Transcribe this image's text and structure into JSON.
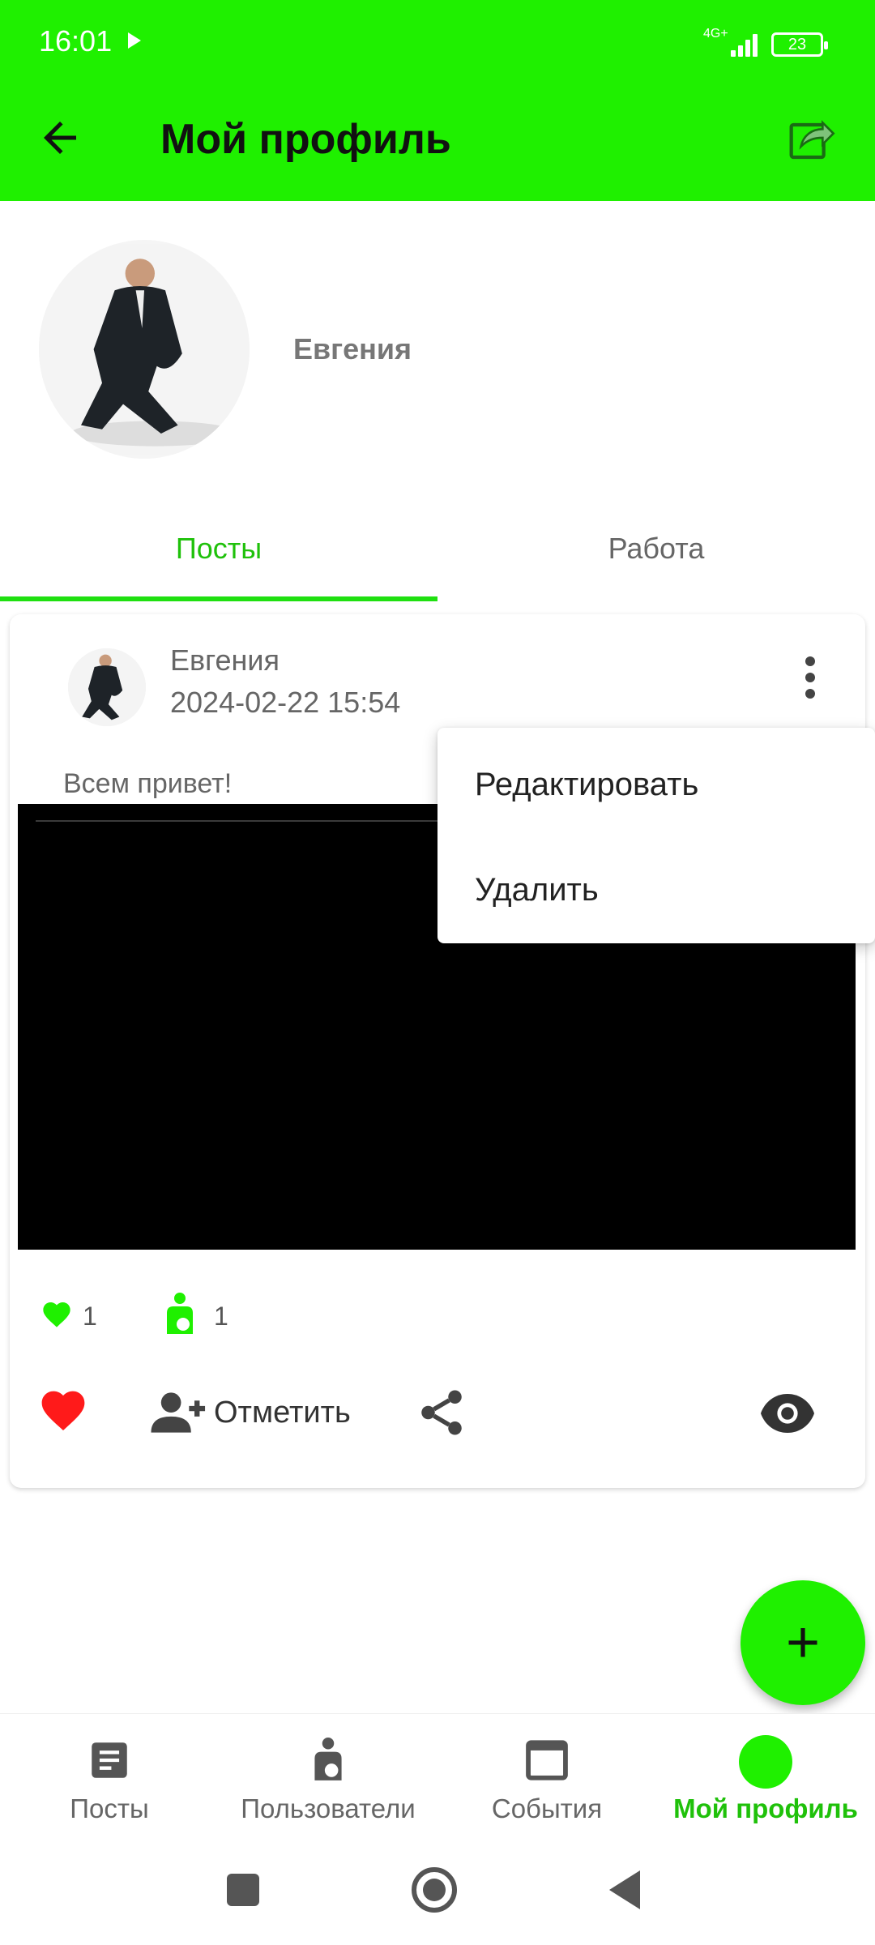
{
  "status_bar": {
    "time": "16:01",
    "network": "4G+",
    "battery": "23"
  },
  "app_bar": {
    "title": "Мой профиль"
  },
  "profile": {
    "name": "Евгения"
  },
  "tabs": [
    {
      "label": "Посты",
      "active": true
    },
    {
      "label": "Работа",
      "active": false
    }
  ],
  "post": {
    "author": "Евгения",
    "date": "2024-02-22 15:54",
    "text": "Всем привет!",
    "likes": "1",
    "tags": "1",
    "tag_action_label": "Отметить"
  },
  "menu": {
    "edit_label": "Редактировать",
    "delete_label": "Удалить"
  },
  "fab": {
    "icon": "plus-icon"
  },
  "bottom_nav": [
    {
      "label": "Посты",
      "icon": "document-icon"
    },
    {
      "label": "Пользователи",
      "icon": "user-icon"
    },
    {
      "label": "События",
      "icon": "calendar-icon"
    },
    {
      "label": "Мой профиль",
      "icon": "profile-dot-icon",
      "active": true
    }
  ],
  "colors": {
    "accent": "#1ff000",
    "active_text": "#1fc10a",
    "like": "#ff1a1a"
  }
}
